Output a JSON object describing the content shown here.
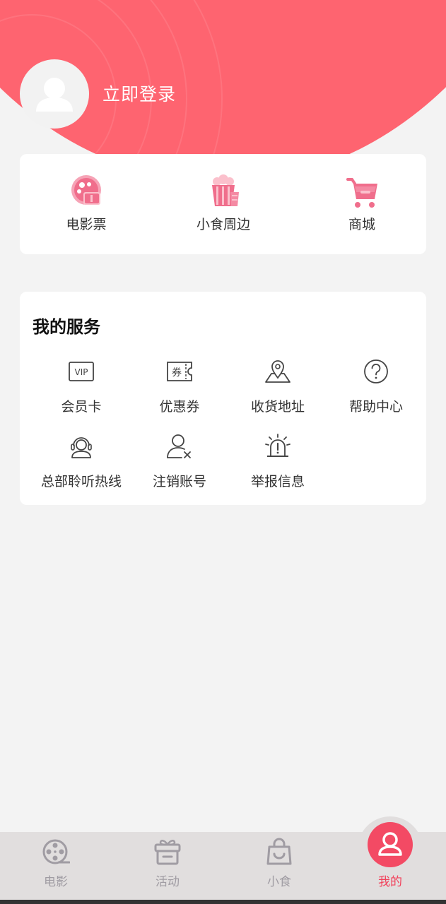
{
  "header": {
    "login_label": "立即登录",
    "bg_color": "#fe6470"
  },
  "quick_actions": [
    {
      "label": "电影票",
      "icon": "film-ticket-icon"
    },
    {
      "label": "小食周边",
      "icon": "popcorn-icon"
    },
    {
      "label": "商城",
      "icon": "cart-icon"
    }
  ],
  "services": {
    "title": "我的服务",
    "items": [
      {
        "label": "会员卡",
        "icon": "vip-card-icon"
      },
      {
        "label": "优惠券",
        "icon": "coupon-icon"
      },
      {
        "label": "收货地址",
        "icon": "location-icon"
      },
      {
        "label": "帮助中心",
        "icon": "help-icon"
      },
      {
        "label": "总部聆听热线",
        "icon": "headset-icon"
      },
      {
        "label": "注销账号",
        "icon": "user-remove-icon"
      },
      {
        "label": "举报信息",
        "icon": "alarm-icon"
      }
    ]
  },
  "tabbar": {
    "items": [
      {
        "label": "电影",
        "icon": "film-reel-icon",
        "active": false
      },
      {
        "label": "活动",
        "icon": "gift-icon",
        "active": false
      },
      {
        "label": "小食",
        "icon": "bag-icon",
        "active": false
      },
      {
        "label": "我的",
        "icon": "user-icon",
        "active": true
      }
    ],
    "active_color": "#f2405a",
    "inactive_color": "#a09ca3"
  }
}
